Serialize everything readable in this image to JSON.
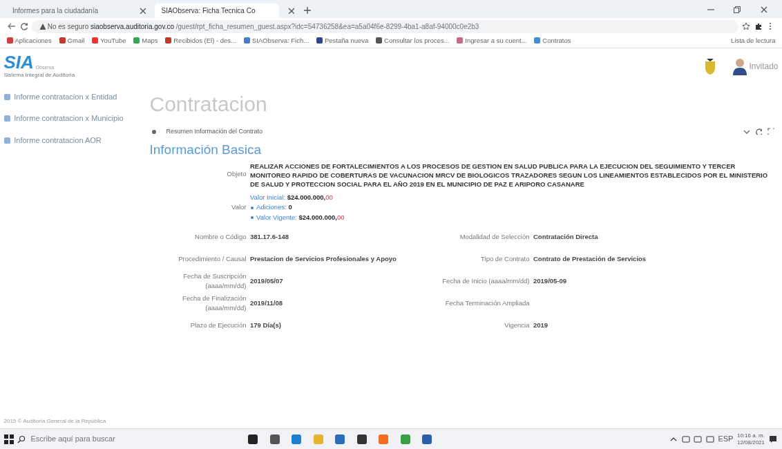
{
  "browser": {
    "tabs": [
      {
        "label": "Informes para la ciudadanía",
        "selected": false
      },
      {
        "label": "SIAObserva: Ficha Tecnica Co",
        "selected": true
      }
    ],
    "security": "No es seguro",
    "url_host": "siaobserva.auditoria.gov.co",
    "url_path": "/guest/rpt_ficha_resumen_guest.aspx?idc=54736258&ea=a5a04f6e-8299-4ba1-a8af-94000c0e2b3",
    "bookmarks": [
      "Aplicaciones",
      "Gmail",
      "YouTube",
      "Maps",
      "Recibidos (El) - des...",
      "SIAObserva: Fich...",
      "Pestaña nueva",
      "Consultar los proces...",
      "Ingresar a su cuent...",
      "Contratos"
    ],
    "reading_list": "Lista de lectura"
  },
  "logo": {
    "mark": "SIA",
    "suffix": "Observa",
    "tagline": "Sistema Integral de Auditoría"
  },
  "user": "Invitado",
  "sidebar": [
    "Informe contratacion x Entidad",
    "Informe contratacion x Municipio",
    "Informe contratacion AOR"
  ],
  "page_title": "Contratacion",
  "panel_title": "Resumen Información del Contrato",
  "section_title": "Información Basica",
  "objeto": {
    "label": "Objeto",
    "text": "REALIZAR ACCIONES DE FORTALECIMIENTOS A LOS PROCESOS DE GESTION EN SALUD PUBLICA PARA LA EJECUCION DEL SEGUIMIENTO Y TERCER MONITOREO RAPIDO DE COBERTURAS DE VACUNACION MRCV DE BIOLOGICOS TRAZADORES SEGUN LOS LINEAMIENTOS ESTABLECIDOS POR EL MINISTERIO DE SALUD Y PROTECCION SOCIAL PARA EL AÑO 2019 EN EL MUNICIPIO DE PAZ E ARIPORO CASANARE"
  },
  "valor": {
    "label": "Valor",
    "lines": [
      {
        "bullet": false,
        "label": "Valor Inicial:",
        "amount": "$24.000.000,",
        "cents": "00"
      },
      {
        "bullet": true,
        "label": "Adiciones:",
        "amount": "0"
      },
      {
        "bullet": true,
        "label": "Valor Vigente:",
        "amount": "$24.000.000,",
        "cents": "00"
      }
    ]
  },
  "fields": [
    [
      {
        "label": "Nombre o Código",
        "value": "381.17.6-148"
      },
      {
        "label": "Modalidad de Selección",
        "value": "Contratación Directa"
      }
    ],
    [
      {
        "label": "Procedimiento / Causal",
        "value": "Prestacion de Servicios Profesionales y Apoyo"
      },
      {
        "label": "Tipo de Contrato",
        "value": "Contrato de Prestación de Servicios"
      }
    ],
    [
      {
        "label": "Fecha de Suscripción (aaaa/mm/dd)",
        "value": "2019/05/07"
      },
      {
        "label": "Fecha de Inicio (aaaa/mm/dd)",
        "value": "2019/05-09"
      }
    ],
    [
      {
        "label": "Fecha de Finalización (aaaa/mm/dd)",
        "value": "2019/11/08"
      },
      {
        "label": "Fecha Terminación Ampliada"
      }
    ],
    [
      {
        "label": "Plazo de Ejecución",
        "value": "179 Día(s)"
      },
      {
        "label": "Vigencia",
        "value": "2019"
      }
    ]
  ],
  "footer": "2015 © Auditoría General de la República",
  "taskbar": {
    "search_placeholder": "Escribe aquí para buscar",
    "language": "ESP",
    "time": "10:16 a. m.",
    "date": "12/08/2021"
  }
}
